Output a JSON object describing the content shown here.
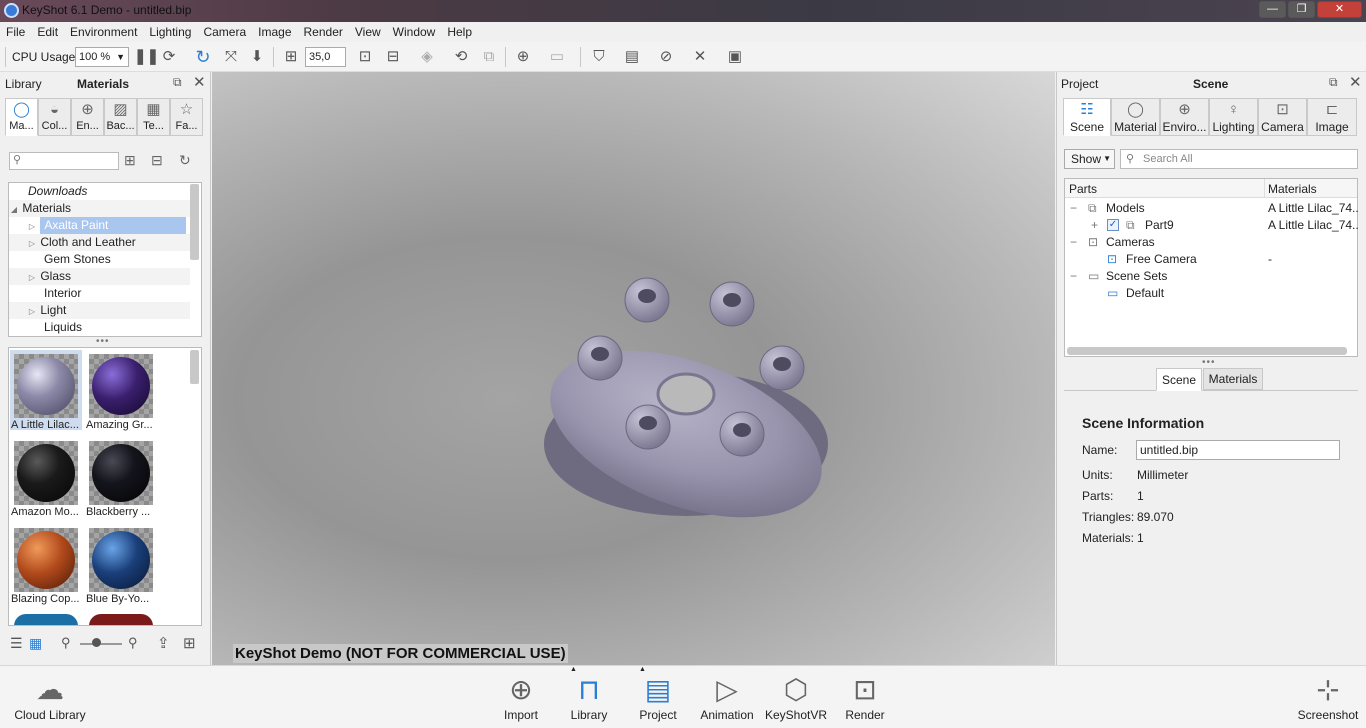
{
  "window": {
    "title": "KeyShot 6.1 Demo  -  untitled.bip",
    "controls": [
      "—",
      "❐",
      "✕"
    ]
  },
  "menu": [
    "File",
    "Edit",
    "Environment",
    "Lighting",
    "Camera",
    "Image",
    "Render",
    "View",
    "Window",
    "Help"
  ],
  "toolbar": {
    "cpu_label": "CPU Usage",
    "cpu_value": "100 %",
    "fov_value": "35,0"
  },
  "library": {
    "header_left": "Library",
    "header_title": "Materials",
    "tabs": [
      "Ma...",
      "Col...",
      "En...",
      "Bac...",
      "Te...",
      "Fa..."
    ],
    "tree": {
      "downloads": "Downloads",
      "materials": "Materials",
      "items": [
        "Axalta Paint",
        "Cloth and Leather",
        "Gem Stones",
        "Glass",
        "Interior",
        "Light",
        "Liquids"
      ]
    },
    "swatches": [
      "A Little Lilac...",
      "Amazing Gr...",
      "Amazon Mo...",
      "Blackberry ...",
      "Blazing Cop...",
      "Blue By-Yo..."
    ],
    "swatch_colors": [
      "#8c8aa8",
      "#3a1f6e",
      "#1a1a1a",
      "#14141c",
      "#b24a1c",
      "#1a3f7a"
    ]
  },
  "viewport": {
    "watermark": "KeyShot Demo (NOT FOR COMMERCIAL USE)"
  },
  "project": {
    "header_left": "Project",
    "header_title": "Scene",
    "tabs": [
      "Scene",
      "Material",
      "Enviro...",
      "Lighting",
      "Camera",
      "Image"
    ],
    "show_label": "Show",
    "search_placeholder": "Search All",
    "col_parts": "Parts",
    "col_materials": "Materials",
    "tree": [
      {
        "name": "Models",
        "material": "A Little Lilac_74..."
      },
      {
        "name": "Part9",
        "material": "A Little Lilac_74..."
      },
      {
        "name": "Cameras",
        "material": ""
      },
      {
        "name": "Free Camera",
        "material": "-"
      },
      {
        "name": "Scene Sets",
        "material": ""
      },
      {
        "name": "Default",
        "material": ""
      }
    ],
    "subtabs": [
      "Scene",
      "Materials"
    ],
    "info": {
      "title": "Scene Information",
      "name_label": "Name:",
      "name_value": "untitled.bip",
      "units_label": "Units:",
      "units_value": "Millimeter",
      "parts_label": "Parts:",
      "parts_value": "1",
      "triangles_label": "Triangles:",
      "triangles_value": "89.070",
      "materials_label": "Materials:",
      "materials_value": "1"
    }
  },
  "bottombar": {
    "cloud_library": "Cloud Library",
    "import": "Import",
    "library": "Library",
    "project": "Project",
    "animation": "Animation",
    "keyshotvr": "KeyShotVR",
    "render": "Render",
    "screenshot": "Screenshot"
  }
}
